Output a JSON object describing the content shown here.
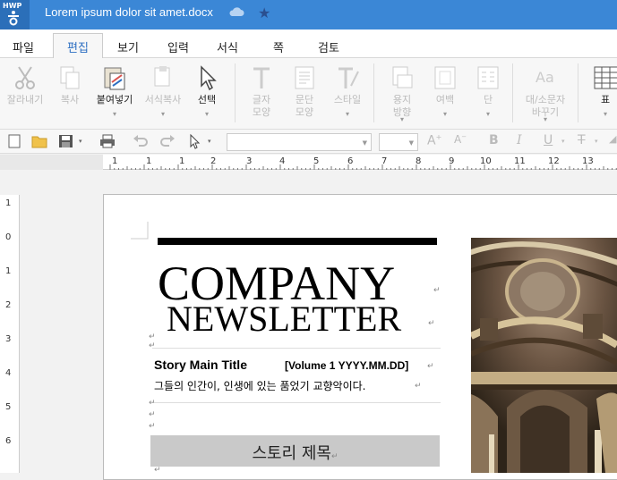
{
  "app": {
    "logo_text": "HWP",
    "doc_title": "Lorem ipsum dolor sit amet.docx"
  },
  "menu": [
    "파일",
    "편집",
    "보기",
    "입력",
    "서식",
    "쪽",
    "검토"
  ],
  "ribbon": [
    {
      "label": "잘라내기",
      "dd": ""
    },
    {
      "label": "복사",
      "dd": ""
    },
    {
      "label": "붙여넣기",
      "dd": "▾"
    },
    {
      "label": "서식복사",
      "dd": "▾"
    },
    {
      "label": "선택",
      "dd": "▾"
    },
    {
      "label": "글자\n모양",
      "dd": ""
    },
    {
      "label": "문단\n모양",
      "dd": ""
    },
    {
      "label": "스타일",
      "dd": "▾"
    },
    {
      "label": "용지\n방향",
      "dd": "▾"
    },
    {
      "label": "여백",
      "dd": "▾"
    },
    {
      "label": "단",
      "dd": "▾"
    },
    {
      "label": "대/소문자\n바꾸기",
      "dd": "▾"
    },
    {
      "label": "표",
      "dd": "▾"
    }
  ],
  "toolbar": {
    "font_value": "",
    "size_value": ""
  },
  "ruler_h": [
    "1",
    "1",
    "2",
    "1",
    "2",
    "3",
    "4",
    "5",
    "6",
    "7",
    "8",
    "9",
    "10",
    "11",
    "12",
    "13"
  ],
  "ruler_v": [
    "1",
    "0",
    "1",
    "2",
    "3",
    "4",
    "5",
    "6"
  ],
  "document": {
    "company": "COMPANY",
    "newsletter": "NEWSLETTER",
    "story_title": "Story Main Title",
    "volume": "[Volume 1 YYYY.MM.DD]",
    "body_line": "그들의 인간이, 인생에 있는 품었기 교향악이다.",
    "section_title": "스토리 제목",
    "pilcrow": "↵"
  },
  "colors": {
    "titlebar": "#3b87d6",
    "accent": "#2d6fc2"
  }
}
